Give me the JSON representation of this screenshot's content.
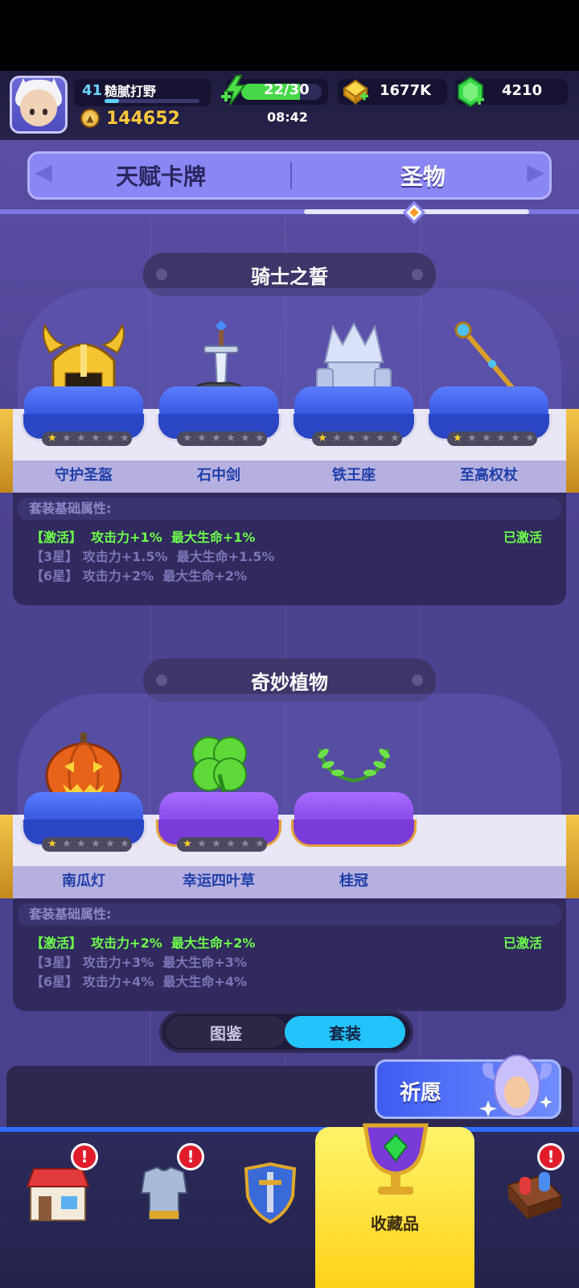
{
  "player": {
    "level": "41",
    "name": "糙腻打野",
    "xp_fraction": 0.15,
    "power": "144652"
  },
  "resources": {
    "energy": "22/30",
    "energy_fraction": 0.73,
    "energy_timer": "08:42",
    "gold": "1677K",
    "gems": "4210"
  },
  "tabs": {
    "talent": "天赋卡牌",
    "relic": "圣物",
    "active": "relic"
  },
  "sets": [
    {
      "title": "骑士之誓",
      "items": [
        {
          "name": "守护圣盔",
          "icon": "golden-helmet-icon",
          "stars": 1
        },
        {
          "name": "石中剑",
          "icon": "sword-in-stone-icon",
          "stars": 0
        },
        {
          "name": "铁王座",
          "icon": "iron-throne-icon",
          "stars": 1
        },
        {
          "name": "至高权杖",
          "icon": "scepter-icon",
          "stars": 1
        }
      ],
      "attr_header": "套装基础属性:",
      "rows": [
        {
          "tag": "【激活】",
          "text": "攻击力+1%  最大生命+1%",
          "status": "已激活",
          "active": true
        },
        {
          "tag": "【3星】",
          "text": "攻击力+1.5%  最大生命+1.5%",
          "active": false
        },
        {
          "tag": "【6星】",
          "text": "攻击力+2%  最大生命+2%",
          "active": false
        }
      ]
    },
    {
      "title": "奇妙植物",
      "items": [
        {
          "name": "南瓜灯",
          "icon": "pumpkin-lantern-icon",
          "stars": 1
        },
        {
          "name": "幸运四叶草",
          "icon": "four-leaf-clover-icon",
          "stars": 1
        },
        {
          "name": "桂冠",
          "icon": "laurel-wreath-icon",
          "stars": 0
        }
      ],
      "attr_header": "套装基础属性:",
      "rows": [
        {
          "tag": "【激活】",
          "text": "攻击力+2%  最大生命+2%",
          "status": "已激活",
          "active": true
        },
        {
          "tag": "【3星】",
          "text": "攻击力+3%  最大生命+3%",
          "active": false
        },
        {
          "tag": "【6星】",
          "text": "攻击力+4%  最大生命+4%",
          "active": false
        }
      ]
    }
  ],
  "view_toggle": {
    "codex": "图鉴",
    "set": "套装",
    "active": "set"
  },
  "pray_button": "祈愿",
  "nav": {
    "shop_icon": "shop-icon",
    "armor_icon": "armor-icon",
    "hero_icon": "shield-sword-icon",
    "collection_label": "收藏品",
    "collection_icon": "trophy-cup-icon",
    "events_icon": "toy-box-icon",
    "badge": "!"
  },
  "colors": {
    "accent_blue": "#22c4ff",
    "active_green": "#6dff4a",
    "gold": "#ffc93a"
  }
}
